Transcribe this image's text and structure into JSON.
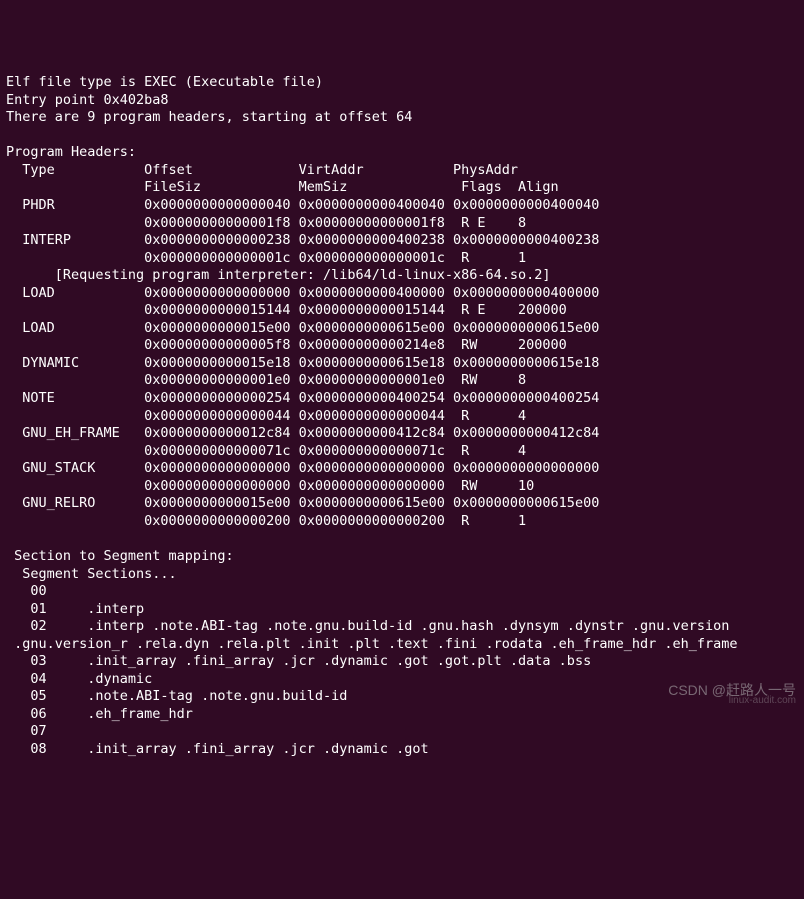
{
  "header": {
    "line1": "Elf file type is EXEC (Executable file)",
    "line2": "Entry point 0x402ba8",
    "line3": "There are 9 program headers, starting at offset 64"
  },
  "ph_title": "Program Headers:",
  "ph_cols1": "  Type           Offset             VirtAddr           PhysAddr",
  "ph_cols2": "                 FileSiz            MemSiz              Flags  Align",
  "ph_rows": [
    "  PHDR           0x0000000000000040 0x0000000000400040 0x0000000000400040",
    "                 0x00000000000001f8 0x00000000000001f8  R E    8",
    "  INTERP         0x0000000000000238 0x0000000000400238 0x0000000000400238",
    "                 0x000000000000001c 0x000000000000001c  R      1",
    "      [Requesting program interpreter: /lib64/ld-linux-x86-64.so.2]",
    "  LOAD           0x0000000000000000 0x0000000000400000 0x0000000000400000",
    "                 0x0000000000015144 0x0000000000015144  R E    200000",
    "  LOAD           0x0000000000015e00 0x0000000000615e00 0x0000000000615e00",
    "                 0x00000000000005f8 0x00000000000214e8  RW     200000",
    "  DYNAMIC        0x0000000000015e18 0x0000000000615e18 0x0000000000615e18",
    "                 0x00000000000001e0 0x00000000000001e0  RW     8",
    "  NOTE           0x0000000000000254 0x0000000000400254 0x0000000000400254",
    "                 0x0000000000000044 0x0000000000000044  R      4",
    "  GNU_EH_FRAME   0x0000000000012c84 0x0000000000412c84 0x0000000000412c84",
    "                 0x000000000000071c 0x000000000000071c  R      4",
    "  GNU_STACK      0x0000000000000000 0x0000000000000000 0x0000000000000000",
    "                 0x0000000000000000 0x0000000000000000  RW     10",
    "  GNU_RELRO      0x0000000000015e00 0x0000000000615e00 0x0000000000615e00",
    "                 0x0000000000000200 0x0000000000000200  R      1"
  ],
  "map_title": " Section to Segment mapping:",
  "map_sub": "  Segment Sections...",
  "map_rows": [
    "   00     ",
    "   01     .interp ",
    "   02     .interp .note.ABI-tag .note.gnu.build-id .gnu.hash .dynsym .dynstr .gnu.version",
    " .gnu.version_r .rela.dyn .rela.plt .init .plt .text .fini .rodata .eh_frame_hdr .eh_frame ",
    "   03     .init_array .fini_array .jcr .dynamic .got .got.plt .data .bss ",
    "   04     .dynamic ",
    "   05     .note.ABI-tag .note.gnu.build-id ",
    "   06     .eh_frame_hdr ",
    "   07     ",
    "   08     .init_array .fini_array .jcr .dynamic .got "
  ],
  "watermark": "CSDN @赶路人一号",
  "watermark2": "linux-audit.com"
}
